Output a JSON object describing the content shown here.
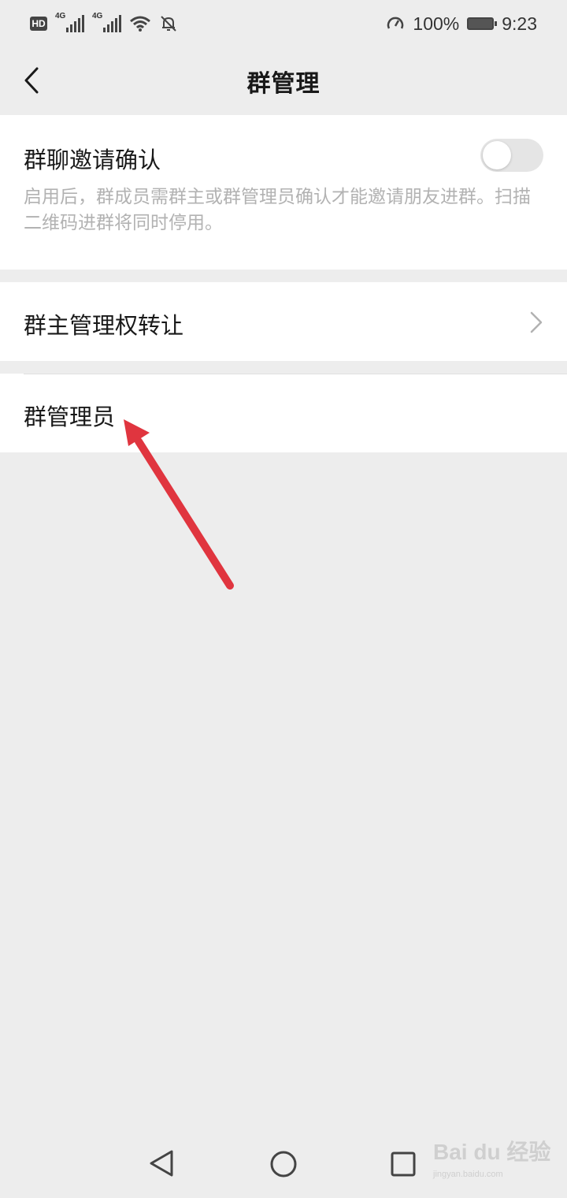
{
  "status_bar": {
    "hd": "HD",
    "sim1_tag": "4G",
    "sim2_tag": "4G",
    "battery_pct": "100%",
    "time": "9:23",
    "icons": [
      "hd-icon",
      "signal-icon",
      "signal-icon",
      "wifi-icon",
      "mute-bell-icon",
      "speedometer-icon",
      "battery-charging-icon"
    ]
  },
  "header": {
    "title": "群管理",
    "back_icon": "chevron-left-icon"
  },
  "settings": {
    "invite_confirm": {
      "label": "群聊邀请确认",
      "description": "启用后，群成员需群主或群管理员确认才能邀请朋友进群。扫描二维码进群将同时停用。",
      "enabled": false
    },
    "transfer_owner": {
      "label": "群主管理权转让"
    },
    "group_admins": {
      "label": "群管理员"
    }
  },
  "annotation": {
    "arrow_color": "#e0353f"
  },
  "system_nav": {
    "icons": [
      "back-triangle-icon",
      "home-circle-icon",
      "recents-square-icon"
    ]
  },
  "watermark": {
    "logo": "Bai du 经验",
    "url": "jingyan.baidu.com"
  },
  "colors": {
    "background": "#ededed",
    "card": "#ffffff",
    "text_primary": "#191919",
    "text_secondary": "#b2b2b2",
    "toggle_off": "#e5e5e5"
  }
}
